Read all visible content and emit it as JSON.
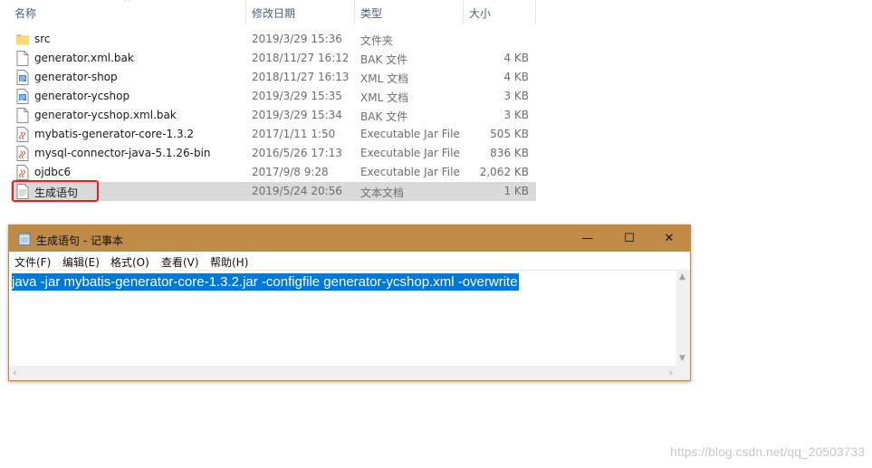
{
  "explorer": {
    "columns": {
      "name": "名称",
      "date": "修改日期",
      "type": "类型",
      "size": "大小"
    },
    "sort_glyph": "^",
    "files": [
      {
        "name": "src",
        "date": "2019/3/29 15:36",
        "type": "文件夹",
        "size": "",
        "icon": "folder-icon"
      },
      {
        "name": "generator.xml.bak",
        "date": "2018/11/27 16:12",
        "type": "BAK 文件",
        "size": "4 KB",
        "icon": "file-icon"
      },
      {
        "name": "generator-shop",
        "date": "2018/11/27 16:13",
        "type": "XML 文档",
        "size": "4 KB",
        "icon": "xml-file-icon"
      },
      {
        "name": "generator-ycshop",
        "date": "2019/3/29 15:35",
        "type": "XML 文档",
        "size": "3 KB",
        "icon": "xml-file-icon"
      },
      {
        "name": "generator-ycshop.xml.bak",
        "date": "2019/3/29 15:34",
        "type": "BAK 文件",
        "size": "3 KB",
        "icon": "file-icon"
      },
      {
        "name": "mybatis-generator-core-1.3.2",
        "date": "2017/1/11 1:50",
        "type": "Executable Jar File",
        "size": "505 KB",
        "icon": "jar-file-icon"
      },
      {
        "name": "mysql-connector-java-5.1.26-bin",
        "date": "2016/5/26 17:13",
        "type": "Executable Jar File",
        "size": "836 KB",
        "icon": "jar-file-icon"
      },
      {
        "name": "ojdbc6",
        "date": "2017/9/8 9:28",
        "type": "Executable Jar File",
        "size": "2,062 KB",
        "icon": "jar-file-icon"
      },
      {
        "name": "生成语句",
        "date": "2019/5/24 20:56",
        "type": "文本文档",
        "size": "1 KB",
        "icon": "text-file-icon"
      }
    ],
    "highlight_color": "#e8211d",
    "selected_color": "#d9d9d9"
  },
  "notepad": {
    "title": "生成语句 - 记事本",
    "buttons": {
      "minimize": "—",
      "maximize": "☐",
      "close": "✕"
    },
    "menu": [
      "文件(F)",
      "编辑(E)",
      "格式(O)",
      "查看(V)",
      "帮助(H)"
    ],
    "content": "java -jar mybatis-generator-core-1.3.2.jar -configfile generator-ycshop.xml -overwrite",
    "selection_color": "#0078d7",
    "titlebar_color": "#c08a47"
  },
  "watermark": "https://blog.csdn.net/qq_20503733"
}
